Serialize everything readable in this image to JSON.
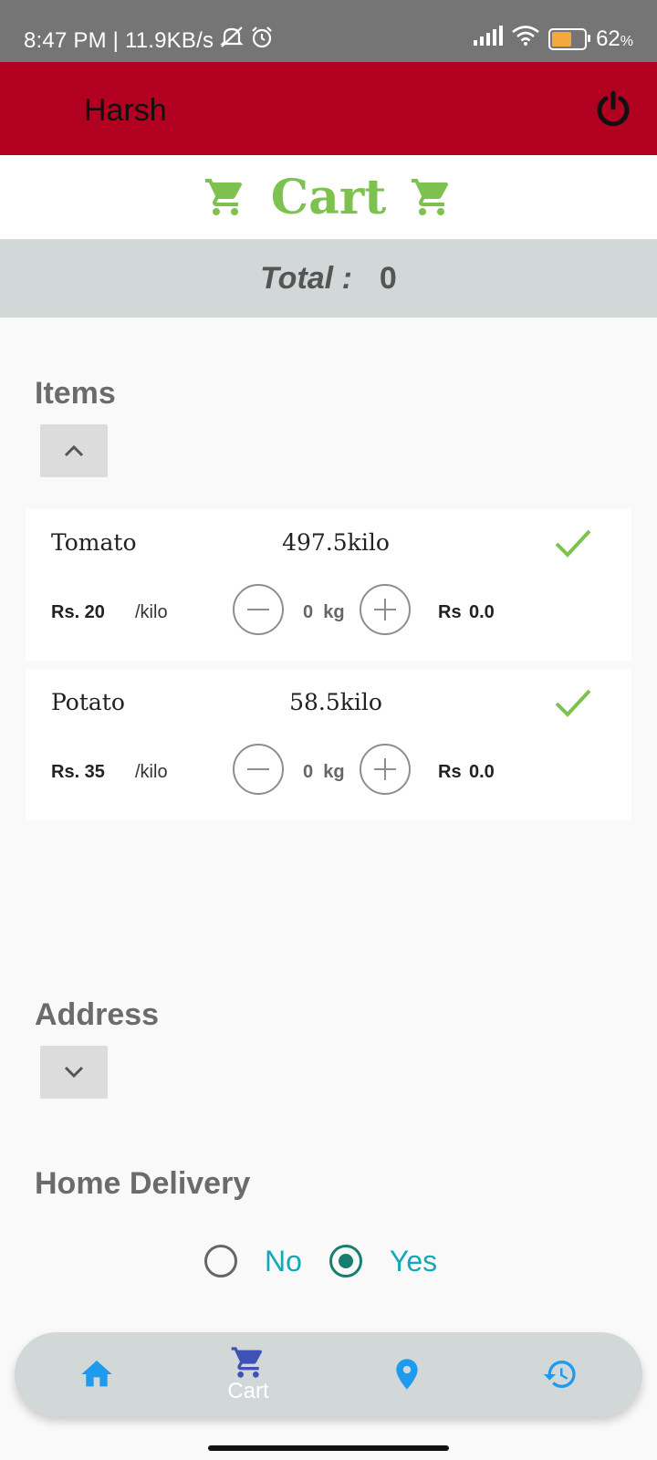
{
  "status_bar": {
    "time_speed": "8:47 PM | 11.9KB/s",
    "battery_percent": "62",
    "battery_symbol": "%",
    "battery_level": 0.62,
    "icons": [
      "mute-icon",
      "alarm-icon",
      "signal-icon",
      "wifi-icon",
      "battery-icon"
    ]
  },
  "app_bar": {
    "user_name": "Harsh",
    "icon": "power-icon",
    "color": "#b10020"
  },
  "cart_header": {
    "title": "Cart",
    "icon": "cart-icon",
    "color": "#7dc24f"
  },
  "total": {
    "label": "Total :",
    "value": "0"
  },
  "items_section": {
    "title": "Items",
    "toggle_icon": "chevron-up-icon",
    "items": [
      {
        "name": "Tomato",
        "stock": "497.5kilo",
        "price": "Rs. 20",
        "unit": "/kilo",
        "quantity": "0",
        "quantity_unit": "kg",
        "total_label": "Rs",
        "total_value": "0.0",
        "status_icon": "check-icon"
      },
      {
        "name": "Potato",
        "stock": "58.5kilo",
        "price": "Rs. 35",
        "unit": "/kilo",
        "quantity": "0",
        "quantity_unit": "kg",
        "total_label": "Rs",
        "total_value": "0.0",
        "status_icon": "check-icon"
      }
    ]
  },
  "address_section": {
    "title": "Address",
    "toggle_icon": "chevron-down-icon"
  },
  "delivery_section": {
    "title": "Home Delivery",
    "options": [
      {
        "label": "No",
        "selected": false
      },
      {
        "label": "Yes",
        "selected": true
      }
    ],
    "accent": "#14a8b8"
  },
  "bottom_nav": {
    "items": [
      {
        "icon": "home-icon",
        "label": ""
      },
      {
        "icon": "cart-icon",
        "label": "Cart",
        "active": true
      },
      {
        "icon": "location-icon",
        "label": ""
      },
      {
        "icon": "history-icon",
        "label": ""
      }
    ]
  }
}
